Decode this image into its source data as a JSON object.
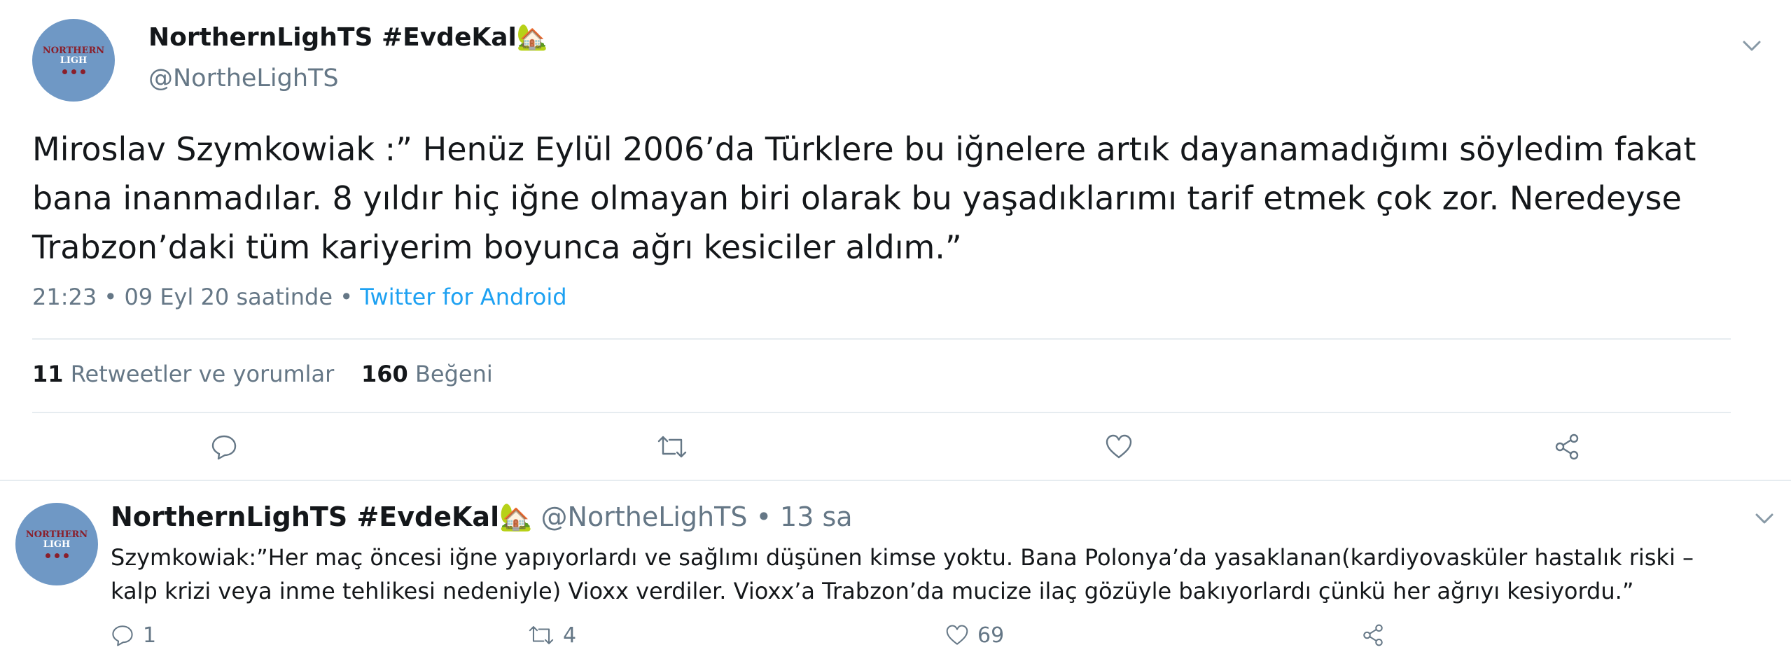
{
  "main_tweet": {
    "display_name": "NorthernLighTS #EvdeKal",
    "name_emoji": "🏡",
    "handle": "@NortheLighTS",
    "avatar_text_line1": "NORTHERN",
    "avatar_text_line2": "LIGH",
    "text": "Miroslav Szymkowiak :” Henüz Eylül 2006’da Türklere bu iğnelere artık dayanamadığımı söyledim fakat bana inanmadılar. 8 yıldır hiç iğne olmayan biri olarak bu yaşadıklarımı tarif etmek çok zor. Neredeyse Trabzon’daki tüm kariyerim boyunca ağrı kesiciler aldım.”",
    "timestamp": "21:23 • 09 Eyl 20 saatinde • ",
    "source": "Twitter for Android",
    "stats": {
      "retweets_count": "11",
      "retweets_label": "Retweetler ve yorumlar",
      "likes_count": "160",
      "likes_label": "Beğeni"
    }
  },
  "reply_tweet": {
    "display_name": "NorthernLighTS #EvdeKal",
    "name_emoji": "🏡",
    "handle": "@NortheLighTS",
    "time": "• 13 sa",
    "avatar_text_line1": "NORTHERN",
    "avatar_text_line2": "LIGH",
    "text": "Szymkowiak:”Her maç öncesi iğne yapıyorlardı ve sağlımı düşünen kimse yoktu. Bana Polonya’da yasaklanan(kardiyovasküler hastalık riski – kalp krizi veya inme tehlikesi nedeniyle) Vioxx verdiler. Vioxx’a Trabzon’da mucize ilaç gözüyle bakıyorlardı çünkü her ağrıyı kesiyordu.”",
    "reply_count": "1",
    "retweet_count": "4",
    "like_count": "69"
  },
  "icons": {
    "reply": "reply-icon",
    "retweet": "retweet-icon",
    "like": "heart-icon",
    "share": "share-icon",
    "menu": "chevron-down-icon"
  },
  "colors": {
    "link": "#1da1f2",
    "secondary_text": "#657786",
    "divider": "#e6ecf0",
    "avatar_bg": "#6f98c5"
  }
}
